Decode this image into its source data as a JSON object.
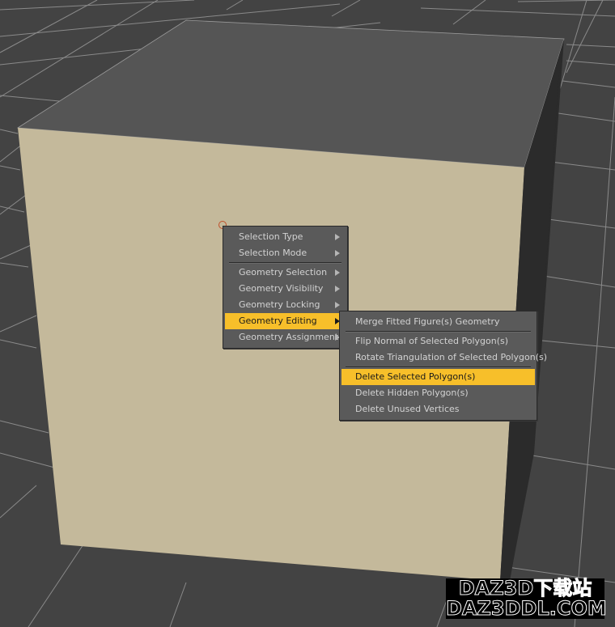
{
  "scene": {
    "colors": {
      "background": "#434343",
      "grid_line": "#8a8a8a",
      "cube_front": "#c4b99b",
      "cube_top": "#555555",
      "cube_side": "#2b2b2b",
      "cursor": "#c0502a"
    }
  },
  "context_menu": {
    "groups": [
      [
        {
          "label": "Selection Type",
          "submenu": true,
          "active": false
        },
        {
          "label": "Selection Mode",
          "submenu": true,
          "active": false
        }
      ],
      [
        {
          "label": "Geometry Selection",
          "submenu": true,
          "active": false
        },
        {
          "label": "Geometry Visibility",
          "submenu": true,
          "active": false
        },
        {
          "label": "Geometry Locking",
          "submenu": true,
          "active": false
        },
        {
          "label": "Geometry Editing",
          "submenu": true,
          "active": true
        },
        {
          "label": "Geometry Assignment",
          "submenu": true,
          "active": false
        }
      ]
    ],
    "highlight_color": "#f7bf2a"
  },
  "submenu": {
    "parent": "Geometry Editing",
    "groups": [
      [
        {
          "label": "Merge Fitted Figure(s) Geometry",
          "active": false
        }
      ],
      [
        {
          "label": "Flip Normal of Selected Polygon(s)",
          "active": false
        },
        {
          "label": "Rotate Triangulation of Selected Polygon(s)",
          "active": false
        }
      ],
      [
        {
          "label": "Delete Selected Polygon(s)",
          "active": true
        },
        {
          "label": "Delete Hidden Polygon(s)",
          "active": false
        },
        {
          "label": "Delete Unused Vertices",
          "active": false
        }
      ]
    ]
  },
  "watermark": {
    "line1": "DAZ3D下载站",
    "line2": "DAZ3DDL.COM"
  }
}
